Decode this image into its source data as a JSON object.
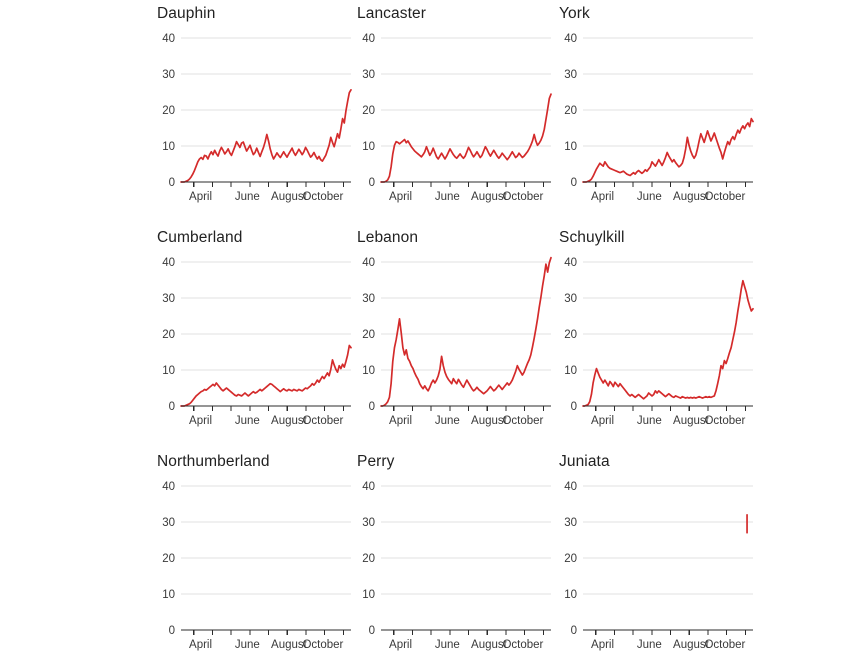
{
  "figure": {
    "background_color": "#ffffff",
    "line_color": "#d42b2b",
    "gridline_color": "#e2e2e2",
    "axis_color": "#2b2b2b",
    "panel_rows": 3,
    "panel_cols": 3
  },
  "axes": {
    "y_ticks": [
      "0",
      "10",
      "20",
      "30",
      "40"
    ],
    "y_tick_values": [
      0,
      10,
      20,
      30,
      40
    ],
    "ylim": [
      0,
      44
    ],
    "x_ticks": [
      "April",
      "June",
      "August",
      "October"
    ],
    "x_tick_positions": [
      0.115,
      0.39,
      0.635,
      0.835
    ],
    "x_minor_tick_count": 9,
    "grid": "horizontal-only",
    "legend": "none"
  },
  "chart_data": [
    {
      "type": "line",
      "title": "Dauphin",
      "xlabel": "",
      "ylabel": "",
      "ylim": [
        0,
        44
      ],
      "x_tick_labels": [
        "April",
        "June",
        "August",
        "October"
      ],
      "y_tick_labels": [
        "0",
        "10",
        "20",
        "30",
        "40"
      ],
      "values": [
        0,
        0,
        0,
        0.2,
        0.4,
        0.8,
        1.4,
        2.2,
        3.2,
        4.4,
        5.6,
        6.4,
        6.8,
        6.3,
        7.4,
        7.2,
        6.4,
        7.6,
        8.4,
        7.6,
        8.8,
        7.9,
        7.2,
        8.6,
        9.6,
        8.8,
        7.8,
        8.4,
        9.2,
        8.1,
        7.4,
        8.6,
        9.8,
        11.2,
        10.4,
        9.6,
        10.8,
        11.1,
        9.8,
        8.6,
        9.4,
        10.2,
        8.8,
        7.6,
        8.2,
        9.4,
        8.2,
        7.1,
        8.4,
        9.6,
        11.2,
        13.2,
        11.4,
        9.2,
        7.6,
        6.4,
        7.2,
        8.1,
        7.4,
        6.8,
        7.6,
        8.4,
        7.6,
        6.9,
        7.8,
        8.6,
        9.4,
        8.2,
        7.4,
        8.2,
        9.1,
        8.4,
        7.6,
        8.4,
        9.6,
        8.8,
        7.8,
        6.9,
        7.4,
        8.2,
        7.2,
        6.4,
        7.1,
        6.2,
        5.8,
        6.6,
        7.4,
        8.8,
        10.2,
        12.4,
        11.0,
        9.8,
        11.6,
        13.4,
        12.2,
        14.8,
        17.6,
        16.4,
        19.8,
        22.4,
        24.8,
        25.6
      ]
    },
    {
      "type": "line",
      "title": "Lancaster",
      "xlabel": "",
      "ylabel": "",
      "ylim": [
        0,
        44
      ],
      "x_tick_labels": [
        "April",
        "June",
        "August",
        "October"
      ],
      "y_tick_labels": [
        "0",
        "10",
        "20",
        "30",
        "40"
      ],
      "values": [
        0,
        0,
        0,
        0.2,
        0.6,
        1.6,
        4.2,
        7.8,
        10.2,
        11.2,
        11.0,
        10.6,
        11.0,
        11.4,
        11.8,
        10.9,
        11.4,
        10.6,
        9.8,
        9.2,
        8.6,
        8.2,
        7.8,
        7.4,
        7.0,
        7.6,
        8.4,
        9.8,
        8.6,
        7.4,
        8.2,
        9.4,
        8.2,
        7.0,
        6.4,
        7.2,
        8.0,
        7.2,
        6.4,
        7.2,
        8.2,
        9.2,
        8.4,
        7.6,
        7.0,
        6.6,
        7.2,
        7.8,
        7.1,
        6.6,
        7.2,
        8.4,
        9.6,
        8.8,
        7.8,
        7.0,
        7.6,
        8.4,
        7.6,
        6.8,
        7.4,
        8.6,
        9.8,
        9.0,
        8.0,
        7.2,
        8.0,
        8.8,
        8.0,
        7.2,
        6.6,
        7.2,
        8.0,
        7.4,
        6.8,
        6.2,
        6.8,
        7.6,
        8.4,
        7.6,
        6.8,
        7.2,
        8.0,
        7.4,
        6.8,
        7.2,
        7.8,
        8.4,
        9.2,
        10.2,
        11.4,
        13.2,
        11.4,
        10.2,
        10.8,
        11.6,
        12.8,
        14.6,
        17.4,
        20.2,
        23.2,
        24.4
      ]
    },
    {
      "type": "line",
      "title": "York",
      "xlabel": "",
      "ylabel": "",
      "ylim": [
        0,
        44
      ],
      "x_tick_labels": [
        "April",
        "June",
        "August",
        "October"
      ],
      "y_tick_labels": [
        "0",
        "10",
        "20",
        "30",
        "40"
      ],
      "values": [
        0,
        0,
        0,
        0.2,
        0.4,
        0.8,
        1.6,
        2.6,
        3.6,
        4.4,
        5.2,
        4.8,
        4.4,
        5.6,
        4.9,
        4.2,
        3.8,
        3.6,
        3.4,
        3.2,
        3.0,
        2.8,
        2.6,
        2.8,
        3.0,
        2.6,
        2.2,
        2.0,
        1.8,
        2.2,
        2.6,
        2.2,
        2.8,
        3.2,
        2.8,
        2.4,
        2.8,
        3.4,
        3.0,
        3.6,
        4.2,
        5.6,
        5.0,
        4.4,
        5.2,
        6.2,
        5.4,
        4.6,
        5.6,
        6.8,
        8.2,
        7.2,
        6.4,
        5.6,
        6.2,
        5.4,
        4.8,
        4.2,
        4.6,
        5.2,
        6.8,
        9.2,
        12.4,
        10.2,
        8.6,
        7.4,
        6.6,
        7.4,
        9.2,
        11.4,
        13.4,
        12.2,
        11.0,
        12.6,
        14.2,
        12.8,
        11.4,
        12.4,
        13.6,
        12.2,
        10.8,
        9.4,
        8.2,
        6.4,
        8.2,
        9.8,
        11.2,
        10.4,
        11.8,
        12.6,
        11.8,
        13.2,
        14.4,
        13.6,
        14.8,
        15.6,
        14.8,
        15.8,
        16.4,
        15.4,
        17.6,
        16.8
      ]
    },
    {
      "type": "line",
      "title": "Cumberland",
      "xlabel": "",
      "ylabel": "",
      "ylim": [
        0,
        44
      ],
      "x_tick_labels": [
        "April",
        "June",
        "August",
        "October"
      ],
      "y_tick_labels": [
        "0",
        "10",
        "20",
        "30",
        "40"
      ],
      "values": [
        0,
        0,
        0,
        0.2,
        0.4,
        0.6,
        1.0,
        1.6,
        2.2,
        2.8,
        3.2,
        3.6,
        4.0,
        4.2,
        4.6,
        4.4,
        4.8,
        5.2,
        5.6,
        6.0,
        5.6,
        6.4,
        5.8,
        5.2,
        4.6,
        4.2,
        4.6,
        5.0,
        4.6,
        4.2,
        3.8,
        3.4,
        3.0,
        2.8,
        3.2,
        3.0,
        2.8,
        3.2,
        3.6,
        3.2,
        2.8,
        3.2,
        3.6,
        4.0,
        3.6,
        3.8,
        4.2,
        4.6,
        4.2,
        4.6,
        5.0,
        5.4,
        5.8,
        6.2,
        6.0,
        5.6,
        5.2,
        4.8,
        4.4,
        4.0,
        4.4,
        4.8,
        4.4,
        4.2,
        4.6,
        4.4,
        4.2,
        4.6,
        4.4,
        4.2,
        4.6,
        4.4,
        4.2,
        4.6,
        5.0,
        4.8,
        5.2,
        5.6,
        6.2,
        5.8,
        6.4,
        7.2,
        6.6,
        7.4,
        8.2,
        7.6,
        8.4,
        9.2,
        8.4,
        10.2,
        12.8,
        11.4,
        10.2,
        9.4,
        11.2,
        10.4,
        11.6,
        10.8,
        12.4,
        14.2,
        16.8,
        16.2
      ]
    },
    {
      "type": "line",
      "title": "Lebanon",
      "xlabel": "",
      "ylabel": "",
      "ylim": [
        0,
        44
      ],
      "x_tick_labels": [
        "April",
        "June",
        "August",
        "October"
      ],
      "y_tick_labels": [
        "0",
        "10",
        "20",
        "30",
        "40"
      ],
      "values": [
        0,
        0,
        0.2,
        0.6,
        1.2,
        2.4,
        6.2,
        12.4,
        16.2,
        18.4,
        21.2,
        24.2,
        20.4,
        16.2,
        14.2,
        15.6,
        13.2,
        12.4,
        11.2,
        10.4,
        9.2,
        8.2,
        7.4,
        6.2,
        5.4,
        4.8,
        5.6,
        4.8,
        4.2,
        5.2,
        6.4,
        7.2,
        6.4,
        7.2,
        8.4,
        10.2,
        13.8,
        11.2,
        9.4,
        8.2,
        7.4,
        6.8,
        6.2,
        7.6,
        6.8,
        6.2,
        7.4,
        6.6,
        5.8,
        5.2,
        6.2,
        7.2,
        6.4,
        5.6,
        4.8,
        4.2,
        4.6,
        5.2,
        4.6,
        4.2,
        3.8,
        3.4,
        3.8,
        4.2,
        4.8,
        5.4,
        4.8,
        4.2,
        4.6,
        5.2,
        5.8,
        5.2,
        4.6,
        5.2,
        5.8,
        6.4,
        5.8,
        6.4,
        7.2,
        8.4,
        9.6,
        11.2,
        10.2,
        9.4,
        8.6,
        9.4,
        10.6,
        11.8,
        12.8,
        14.2,
        16.4,
        18.8,
        21.4,
        24.2,
        27.4,
        30.2,
        33.4,
        36.2,
        39.4,
        37.2,
        39.8,
        41.2
      ]
    },
    {
      "type": "line",
      "title": "Schuylkill",
      "xlabel": "",
      "ylabel": "",
      "ylim": [
        0,
        44
      ],
      "x_tick_labels": [
        "April",
        "June",
        "August",
        "October"
      ],
      "y_tick_labels": [
        "0",
        "10",
        "20",
        "30",
        "40"
      ],
      "values": [
        0,
        0,
        0.2,
        0.4,
        1.2,
        3.2,
        6.4,
        8.6,
        10.4,
        9.2,
        8.0,
        7.2,
        6.4,
        7.2,
        6.4,
        5.6,
        6.8,
        6.2,
        5.4,
        6.6,
        6.0,
        5.4,
        6.2,
        5.6,
        5.0,
        4.4,
        3.8,
        3.2,
        2.8,
        3.2,
        2.8,
        2.4,
        2.8,
        3.2,
        2.8,
        2.4,
        2.0,
        2.4,
        2.8,
        3.6,
        3.2,
        2.8,
        3.2,
        4.2,
        3.6,
        4.2,
        3.8,
        3.4,
        3.0,
        2.6,
        3.0,
        3.4,
        3.0,
        2.6,
        2.4,
        2.8,
        2.6,
        2.4,
        2.2,
        2.6,
        2.4,
        2.2,
        2.4,
        2.2,
        2.4,
        2.2,
        2.4,
        2.2,
        2.4,
        2.6,
        2.4,
        2.2,
        2.4,
        2.6,
        2.4,
        2.6,
        2.4,
        2.6,
        2.8,
        4.2,
        6.2,
        8.4,
        11.2,
        10.4,
        12.6,
        11.8,
        13.2,
        14.8,
        16.2,
        18.4,
        20.6,
        23.2,
        26.4,
        29.2,
        32.4,
        34.8,
        33.2,
        31.6,
        29.4,
        27.8,
        26.4,
        27.0
      ]
    },
    {
      "type": "line",
      "title": "Northumberland",
      "xlabel": "",
      "ylabel": "",
      "ylim": [
        0,
        44
      ],
      "x_tick_labels": [
        "April",
        "June",
        "August",
        "October"
      ],
      "y_tick_labels": [
        "0",
        "10",
        "20",
        "30",
        "40"
      ],
      "values": []
    },
    {
      "type": "line",
      "title": "Perry",
      "xlabel": "",
      "ylabel": "",
      "ylim": [
        0,
        44
      ],
      "x_tick_labels": [
        "April",
        "June",
        "August",
        "October"
      ],
      "y_tick_labels": [
        "0",
        "10",
        "20",
        "30",
        "40"
      ],
      "values": []
    },
    {
      "type": "line",
      "title": "Juniata",
      "xlabel": "",
      "ylabel": "",
      "ylim": [
        0,
        44
      ],
      "x_tick_labels": [
        "April",
        "June",
        "August",
        "October"
      ],
      "y_tick_labels": [
        "0",
        "10",
        "20",
        "30",
        "40"
      ],
      "values": [],
      "partial_marker": {
        "x_fraction": 0.965,
        "value_top": 32,
        "value_bottom": 27
      }
    }
  ]
}
